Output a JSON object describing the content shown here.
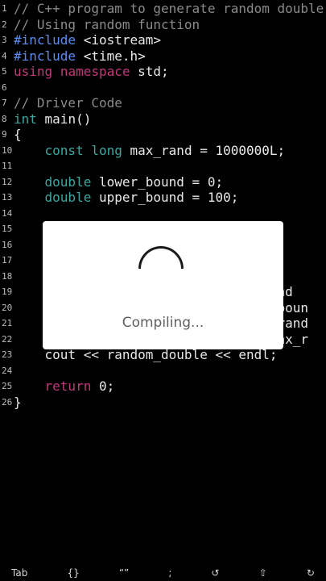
{
  "editor": {
    "lines": [
      {
        "n": "1",
        "tokens": [
          {
            "t": "// C++ program to generate random double",
            "c": "c-comment"
          }
        ]
      },
      {
        "n": "2",
        "tokens": [
          {
            "t": "// Using random function",
            "c": "c-comment"
          }
        ]
      },
      {
        "n": "3",
        "tokens": [
          {
            "t": "#include",
            "c": "c-pre"
          },
          {
            "t": " <iostream>",
            "c": "c-plain"
          }
        ]
      },
      {
        "n": "4",
        "tokens": [
          {
            "t": "#include",
            "c": "c-pre"
          },
          {
            "t": " <time.h>",
            "c": "c-plain"
          }
        ]
      },
      {
        "n": "5",
        "tokens": [
          {
            "t": "using",
            "c": "c-kw"
          },
          {
            "t": " ",
            "c": "c-plain"
          },
          {
            "t": "namespace",
            "c": "c-kw"
          },
          {
            "t": " std;",
            "c": "c-plain"
          }
        ]
      },
      {
        "n": "6",
        "tokens": [
          {
            "t": "",
            "c": "c-plain"
          }
        ]
      },
      {
        "n": "7",
        "tokens": [
          {
            "t": "// Driver Code",
            "c": "c-comment"
          }
        ]
      },
      {
        "n": "8",
        "tokens": [
          {
            "t": "int",
            "c": "c-type"
          },
          {
            "t": " main()",
            "c": "c-plain"
          }
        ]
      },
      {
        "n": "9",
        "tokens": [
          {
            "t": "{",
            "c": "c-plain"
          }
        ]
      },
      {
        "n": "10",
        "tokens": [
          {
            "t": "    ",
            "c": "c-plain"
          },
          {
            "t": "const",
            "c": "c-type"
          },
          {
            "t": " ",
            "c": "c-plain"
          },
          {
            "t": "long",
            "c": "c-type"
          },
          {
            "t": " max_rand = 1000000L;",
            "c": "c-plain"
          }
        ]
      },
      {
        "n": "11",
        "tokens": [
          {
            "t": "",
            "c": "c-plain"
          }
        ]
      },
      {
        "n": "12",
        "tokens": [
          {
            "t": "    ",
            "c": "c-plain"
          },
          {
            "t": "double",
            "c": "c-type"
          },
          {
            "t": " lower_bound = 0;",
            "c": "c-plain"
          }
        ]
      },
      {
        "n": "13",
        "tokens": [
          {
            "t": "    ",
            "c": "c-plain"
          },
          {
            "t": "double",
            "c": "c-type"
          },
          {
            "t": " upper_bound = 100;",
            "c": "c-plain"
          }
        ]
      },
      {
        "n": "14",
        "tokens": [
          {
            "t": "",
            "c": "c-plain"
          }
        ]
      },
      {
        "n": "15",
        "tokens": [
          {
            "t": "",
            "c": "c-plain"
          }
        ]
      },
      {
        "n": "16",
        "tokens": [
          {
            "t": "",
            "c": "c-plain"
          }
        ]
      },
      {
        "n": "17",
        "tokens": [
          {
            "t": "",
            "c": "c-plain"
          }
        ]
      },
      {
        "n": "18",
        "tokens": [
          {
            "t": "",
            "c": "c-plain"
          }
        ]
      },
      {
        "n": "19",
        "tokens": [
          {
            "t": "                                ound",
            "c": "c-plain"
          }
        ]
      },
      {
        "n": "20",
        "tokens": [
          {
            "t": "                                r_boun",
            "c": "c-plain"
          }
        ]
      },
      {
        "n": "21",
        "tokens": [
          {
            "t": "                                 (rand",
            "c": "c-plain"
          }
        ]
      },
      {
        "n": "22",
        "tokens": [
          {
            "t": "                                 max_r",
            "c": "c-plain"
          }
        ]
      },
      {
        "n": "23",
        "tokens": [
          {
            "t": "    cout << random_double << endl;",
            "c": "c-plain"
          }
        ]
      },
      {
        "n": "24",
        "tokens": [
          {
            "t": "",
            "c": "c-plain"
          }
        ]
      },
      {
        "n": "25",
        "tokens": [
          {
            "t": "    ",
            "c": "c-plain"
          },
          {
            "t": "return",
            "c": "c-kw"
          },
          {
            "t": " 0;",
            "c": "c-plain"
          }
        ]
      },
      {
        "n": "26",
        "tokens": [
          {
            "t": "}",
            "c": "c-plain"
          }
        ]
      }
    ]
  },
  "dialog": {
    "status_text": "Compiling..."
  },
  "toolbar": {
    "keys": [
      {
        "label": "Tab",
        "name": "tab-key"
      },
      {
        "label": "{}",
        "name": "braces-key"
      },
      {
        "label": "“”",
        "name": "quotes-key"
      },
      {
        "label": ";",
        "name": "semicolon-key"
      },
      {
        "label": "↺",
        "name": "undo-icon"
      },
      {
        "label": "⇧",
        "name": "shift-icon"
      },
      {
        "label": "↻",
        "name": "redo-icon"
      }
    ]
  }
}
